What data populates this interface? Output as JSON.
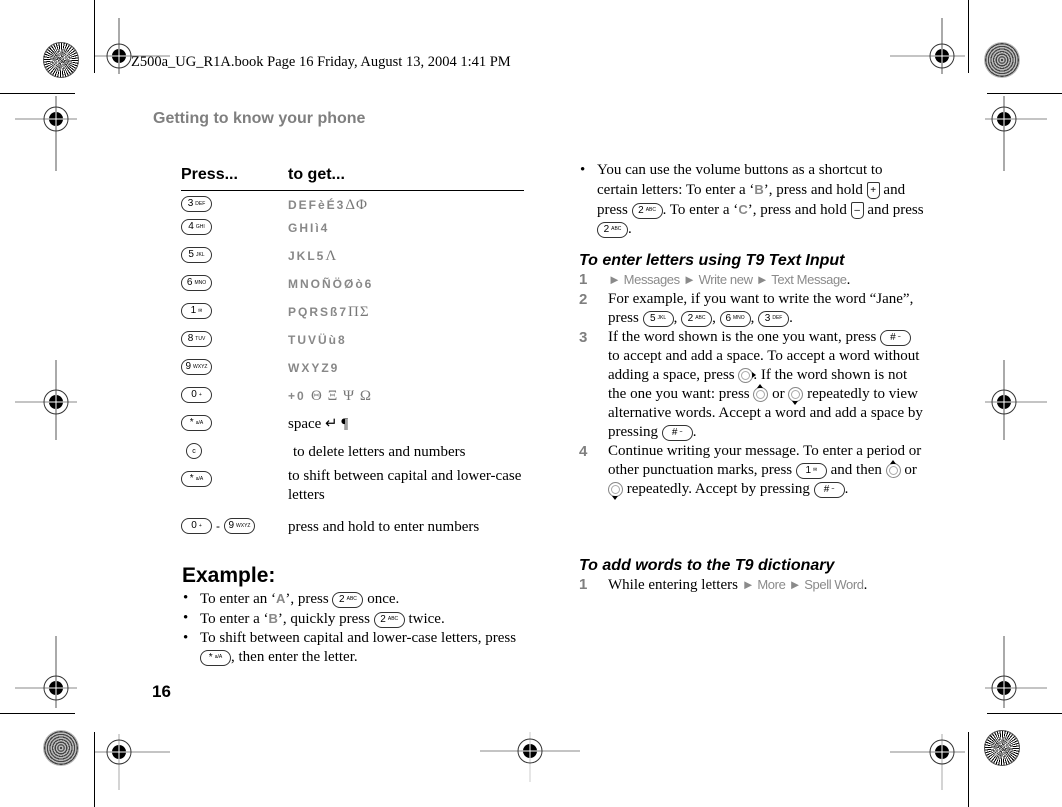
{
  "slug": "Z500a_UG_R1A.book  Page 16  Friday, August 13, 2004  1:41 PM",
  "section_title": "Getting to know your phone",
  "page_number": "16",
  "table": {
    "headers": [
      "Press...",
      "to get..."
    ],
    "rows": [
      {
        "key": {
          "n": "3",
          "s": "DEF"
        },
        "chars": "DEFèÉ3",
        "greek": "ΔΦ"
      },
      {
        "key": {
          "n": "4",
          "s": "GHI"
        },
        "chars": "GHIì4",
        "greek": ""
      },
      {
        "key": {
          "n": "5",
          "s": "JKL"
        },
        "chars": "JKL5",
        "greek": "Λ"
      },
      {
        "key": {
          "n": "6",
          "s": "MNO"
        },
        "chars": "MNOÑÖØò6",
        "greek": ""
      },
      {
        "key": {
          "n": "1",
          "s": "✉"
        },
        "chars": "PQRSß7",
        "greek": "ΠΣ"
      },
      {
        "key": {
          "n": "8",
          "s": "TUV"
        },
        "chars": "TUVÜù8",
        "greek": ""
      },
      {
        "key": {
          "n": "9",
          "s": "WXYZ"
        },
        "chars": "WXYZ9",
        "greek": ""
      },
      {
        "key": {
          "n": "0",
          "s": "+"
        },
        "chars": "+0",
        "greek": "Θ Ξ Ψ Ω"
      },
      {
        "key": {
          "n": "*",
          "s": "a/A"
        },
        "text": "space ↵ ¶"
      },
      {
        "key": {
          "n": "c",
          "s": ""
        },
        "text": "to delete letters and numbers"
      },
      {
        "key": {
          "n": "*",
          "s": "a/A"
        },
        "text": "to shift between capital and lower-case letters"
      },
      {
        "key_from": {
          "n": "0",
          "s": "+"
        },
        "dash": "-",
        "key_to": {
          "n": "9",
          "s": "WXYZ"
        },
        "text": "press and hold to enter numbers"
      }
    ]
  },
  "example": {
    "title": "Example:",
    "b1": {
      "pre": "To enter an ‘",
      "letter": "A",
      "mid": "’, press ",
      "key": {
        "n": "2",
        "s": "ABC"
      },
      "post": " once."
    },
    "b2": {
      "pre": "To enter a ‘",
      "letter": "B",
      "mid": "’, quickly press ",
      "key": {
        "n": "2",
        "s": "ABC"
      },
      "post": " twice."
    },
    "b3": {
      "pre": "To shift between capital and lower-case letters, press ",
      "key": {
        "n": "*",
        "s": "a/A"
      },
      "post": ", then enter the letter."
    }
  },
  "volume_tip": {
    "p1": "You can use the volume buttons as a shortcut to certain letters: To enter a ‘",
    "letter_b": "B",
    "p2": "’, press and hold ",
    "vol_up": "+",
    "p3": " and press ",
    "p4": ". To enter a ‘",
    "letter_c": "C",
    "p5": "’, press and hold ",
    "vol_down": "–",
    "p6": " and press ",
    "p7": ".",
    "key": {
      "n": "2",
      "s": "ABC"
    }
  },
  "t9": {
    "title": "To enter letters using T9 Text Input",
    "step1": {
      "num": "1",
      "menu": "► Messages ► Write new ► Text Message",
      "post": "."
    },
    "step2": {
      "num": "2",
      "pre": "For example, if you want to write the word “Jane”, press ",
      "keys": [
        {
          "n": "5",
          "s": "JKL"
        },
        {
          "n": "2",
          "s": "ABC"
        },
        {
          "n": "6",
          "s": "MNO"
        },
        {
          "n": "3",
          "s": "DEF"
        }
      ],
      "sep": ", ",
      "post": "."
    },
    "step3": {
      "num": "3",
      "a": "If the word shown is the one you want, press ",
      "hash": {
        "n": "#",
        "s": "⌣"
      },
      "b": " to accept and add a space. To accept a word without adding a space, press ",
      "c": ". If the word shown is not the one you want: press ",
      "d": " or ",
      "e": " repeatedly to view alternative words. Accept a word and add a space by pressing ",
      "f": "."
    },
    "step4": {
      "num": "4",
      "a": "Continue writing your message. To enter a period or other punctuation marks, press ",
      "key1": {
        "n": "1",
        "s": "✉"
      },
      "b": " and then ",
      "c": " or ",
      "d": " repeatedly. Accept by pressing ",
      "e": "."
    }
  },
  "dictionary": {
    "title": "To add words to the T9 dictionary",
    "step1": {
      "num": "1",
      "pre": "While entering letters ",
      "menu": "► More ► Spell Word",
      "post": "."
    }
  }
}
